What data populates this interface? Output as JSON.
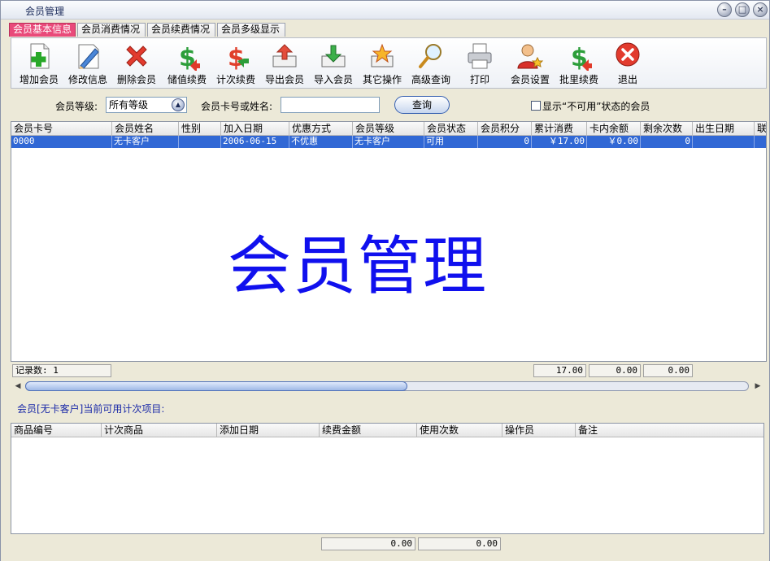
{
  "window": {
    "title": "会员管理"
  },
  "tabs": [
    {
      "label": "会员基本信息",
      "active": true
    },
    {
      "label": "会员消费情况",
      "active": false
    },
    {
      "label": "会员续费情况",
      "active": false
    },
    {
      "label": "会员多级显示",
      "active": false
    }
  ],
  "toolbar": [
    {
      "label": "增加会员",
      "icon": "add-member-icon"
    },
    {
      "label": "修改信息",
      "icon": "edit-icon"
    },
    {
      "label": "删除会员",
      "icon": "delete-icon"
    },
    {
      "label": "储值续费",
      "icon": "dollar-icon"
    },
    {
      "label": "计次续费",
      "icon": "dollar-icon"
    },
    {
      "label": "导出会员",
      "icon": "export-icon"
    },
    {
      "label": "导入会员",
      "icon": "import-icon"
    },
    {
      "label": "其它操作",
      "icon": "star-icon"
    },
    {
      "label": "高级查询",
      "icon": "magnifier-icon"
    },
    {
      "label": "打印",
      "icon": "printer-icon"
    },
    {
      "label": "会员设置",
      "icon": "member-settings-icon"
    },
    {
      "label": "批里续费",
      "icon": "dollar-icon"
    },
    {
      "label": "退出",
      "icon": "exit-icon"
    }
  ],
  "filter": {
    "level_label": "会员等级:",
    "level_value": "所有等级",
    "search_label": "会员卡号或姓名:",
    "search_value": "",
    "query_button": "查询",
    "show_unavailable_label": "显示“不可用”状态的会员",
    "show_unavailable_checked": false
  },
  "members_table": {
    "columns": [
      "会员卡号",
      "会员姓名",
      "性别",
      "加入日期",
      "优惠方式",
      "会员等级",
      "会员状态",
      "会员积分",
      "累计消费",
      "卡内余额",
      "剩余次数",
      "出生日期",
      "联"
    ],
    "rows": [
      [
        "0000",
        "无卡客户",
        "",
        "2006-06-15",
        "不优惠",
        "无卡客户",
        "可用",
        "0",
        "￥17.00",
        "￥0.00",
        "0",
        "",
        ""
      ]
    ],
    "watermark": "会员管理"
  },
  "summary": {
    "record_count": "记录数: 1",
    "total_consumption": "17.00",
    "total_balance": "0.00",
    "total_remaining": "0.00"
  },
  "count_items": {
    "label": "会员[无卡客户]当前可用计次项目:",
    "columns": [
      "商品编号",
      "计次商品",
      "添加日期",
      "续费金额",
      "使用次数",
      "操作员",
      "备注"
    ],
    "total_amount": "0.00",
    "total_uses": "0.00"
  },
  "colors": {
    "active_tab": "#e94a7a",
    "selected_row": "#3168d5",
    "watermark": "#1010ee"
  }
}
